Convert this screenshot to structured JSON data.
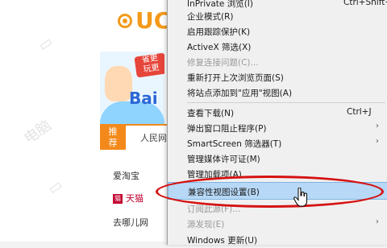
{
  "browser_page": {
    "logo_text": "UC",
    "ad": {
      "badge": "省更\n玩更",
      "brand": "Bai"
    },
    "tabs": [
      {
        "label": "推\n荐"
      },
      {
        "label": "人民网"
      }
    ],
    "sites": [
      "爱淘宝",
      "天猫",
      "去哪儿网"
    ],
    "watermark": "电脑"
  },
  "context_menu": {
    "items": [
      {
        "label": "InPrivate 浏览(I)",
        "shortcut": "Ctrl+Shift+P",
        "submenu": false,
        "disabled": false,
        "partial": true
      },
      {
        "label": "企业模式(R)",
        "shortcut": "",
        "submenu": false,
        "disabled": false
      },
      {
        "label": "启用跟踪保护(K)",
        "shortcut": "",
        "submenu": false,
        "disabled": false
      },
      {
        "label": "ActiveX 筛选(X)",
        "shortcut": "",
        "submenu": false,
        "disabled": false
      },
      {
        "label": "修复连接问题(C)...",
        "shortcut": "",
        "submenu": false,
        "disabled": true
      },
      {
        "label": "重新打开上次浏览页面(S)",
        "shortcut": "",
        "submenu": false,
        "disabled": false
      },
      {
        "label": "将站点添加到\"应用\"视图(A)",
        "shortcut": "",
        "submenu": false,
        "disabled": false
      },
      {
        "label": "查看下载(N)",
        "shortcut": "Ctrl+J",
        "submenu": false,
        "disabled": false
      },
      {
        "label": "弹出窗口阻止程序(P)",
        "shortcut": "",
        "submenu": true,
        "disabled": false
      },
      {
        "label": "SmartScreen 筛选器(T)",
        "shortcut": "",
        "submenu": true,
        "disabled": false
      },
      {
        "label": "管理媒体许可证(M)",
        "shortcut": "",
        "submenu": false,
        "disabled": false
      },
      {
        "label": "管理加载项(A)",
        "shortcut": "",
        "submenu": false,
        "disabled": false
      },
      {
        "label": "兼容性视图设置(B)",
        "shortcut": "",
        "submenu": false,
        "disabled": false,
        "highlighted": true
      },
      {
        "label": "订阅此源(F)...",
        "shortcut": "",
        "submenu": false,
        "disabled": true
      },
      {
        "label": "源发现(E)",
        "shortcut": "",
        "submenu": true,
        "disabled": true
      },
      {
        "label": "Windows 更新(U)",
        "shortcut": "",
        "submenu": false,
        "disabled": false
      }
    ]
  },
  "colors": {
    "accent_orange": "#f39a1b",
    "highlight_bg": "#b7d8f6",
    "annotation_red": "#d51212",
    "tmall_red": "#c2002f"
  }
}
